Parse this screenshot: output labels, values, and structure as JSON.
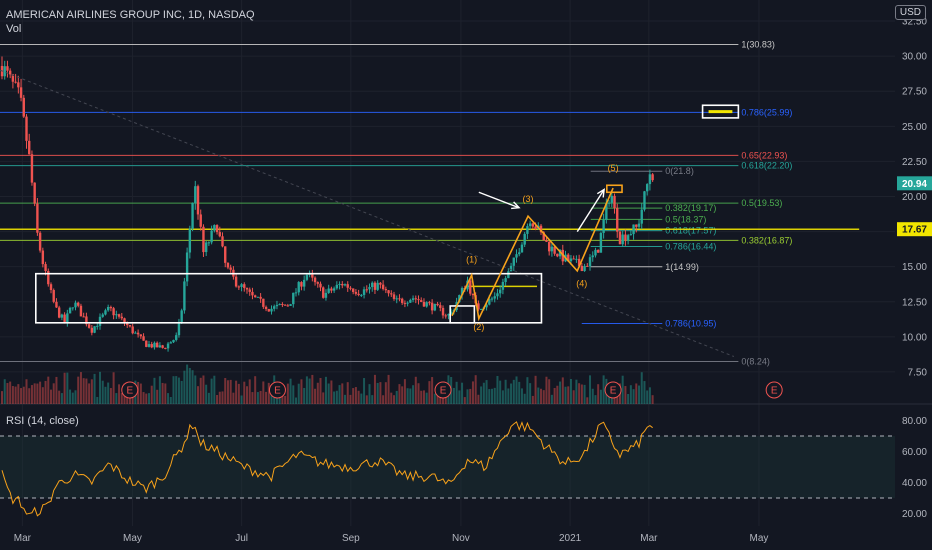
{
  "header": {
    "symbol_title": "AMERICAN AIRLINES GROUP INC, 1D, NASDAQ",
    "volume_label": "Vol",
    "currency_button": "USD"
  },
  "rsi_label": "RSI (14, close)",
  "colors": {
    "background": "#131722",
    "up": "#26a69a",
    "down": "#ef5350",
    "wave": "#f7a21b",
    "rsi": "#f7a21b",
    "fib_white": "#c8c8c8",
    "fib_blue": "#2962ff",
    "fib_green": "#4caf50",
    "yellow": "#f2e600"
  },
  "chart_data": {
    "type": "candlestick",
    "x_labels": [
      "Mar",
      "May",
      "Jul",
      "Sep",
      "Nov",
      "2021",
      "Mar",
      "May"
    ],
    "price_axis": {
      "ticks": [
        7.5,
        10,
        12.5,
        15,
        17.5,
        20,
        22.5,
        25,
        27.5,
        30,
        32.5
      ],
      "tick_labels": [
        "7.50",
        "10.00",
        "12.50",
        "15.00",
        "17.50",
        "20.00",
        "22.50",
        "25.00",
        "27.50",
        "30.00",
        "32.50"
      ],
      "range": [
        5.5,
        34
      ],
      "price_tags": [
        {
          "label": "20.94",
          "value": 20.94,
          "color": "#26a69a"
        },
        {
          "label": "17.67",
          "value": 17.67,
          "color": "#f2e600"
        }
      ]
    },
    "rsi_axis": {
      "ticks": [
        20,
        40,
        60,
        80
      ],
      "tick_labels": [
        "20.00",
        "40.00",
        "60.00",
        "80.00"
      ],
      "range": [
        12,
        88
      ],
      "bands": [
        30,
        70
      ]
    },
    "price_path": [
      [
        0,
        29.3
      ],
      [
        0.02,
        27.0
      ],
      [
        0.03,
        23.0
      ],
      [
        0.04,
        17.0
      ],
      [
        0.05,
        14.0
      ],
      [
        0.06,
        12.0
      ],
      [
        0.07,
        11.0
      ],
      [
        0.08,
        12.5
      ],
      [
        0.1,
        10.5
      ],
      [
        0.12,
        12.0
      ],
      [
        0.14,
        10.8
      ],
      [
        0.16,
        9.5
      ],
      [
        0.18,
        9.2
      ],
      [
        0.195,
        10.0
      ],
      [
        0.2,
        11.5
      ],
      [
        0.215,
        21.0
      ],
      [
        0.225,
        16.0
      ],
      [
        0.24,
        18.0
      ],
      [
        0.25,
        15.0
      ],
      [
        0.26,
        14.0
      ],
      [
        0.28,
        12.8
      ],
      [
        0.3,
        12.0
      ],
      [
        0.32,
        12.3
      ],
      [
        0.34,
        14.5
      ],
      [
        0.36,
        13.0
      ],
      [
        0.38,
        13.8
      ],
      [
        0.4,
        13.2
      ],
      [
        0.42,
        13.7
      ],
      [
        0.44,
        12.5
      ],
      [
        0.46,
        12.8
      ],
      [
        0.48,
        12.2
      ],
      [
        0.5,
        11.5
      ],
      [
        0.52,
        14.0
      ],
      [
        0.53,
        12.0
      ],
      [
        0.55,
        12.8
      ],
      [
        0.57,
        15.0
      ],
      [
        0.59,
        18.5
      ],
      [
        0.61,
        16.5
      ],
      [
        0.63,
        15.5
      ],
      [
        0.65,
        15.0
      ],
      [
        0.665,
        16.0
      ],
      [
        0.68,
        20.5
      ],
      [
        0.69,
        17.0
      ],
      [
        0.71,
        17.8
      ],
      [
        0.725,
        22.0
      ],
      [
        0.73,
        20.94
      ]
    ],
    "rsi_path": [
      [
        0,
        45
      ],
      [
        0.01,
        30
      ],
      [
        0.02,
        28
      ],
      [
        0.03,
        18
      ],
      [
        0.04,
        22
      ],
      [
        0.05,
        24
      ],
      [
        0.06,
        38
      ],
      [
        0.08,
        45
      ],
      [
        0.1,
        40
      ],
      [
        0.12,
        52
      ],
      [
        0.14,
        42
      ],
      [
        0.16,
        36
      ],
      [
        0.18,
        44
      ],
      [
        0.2,
        62
      ],
      [
        0.215,
        80
      ],
      [
        0.22,
        66
      ],
      [
        0.24,
        60
      ],
      [
        0.27,
        50
      ],
      [
        0.3,
        44
      ],
      [
        0.33,
        58
      ],
      [
        0.36,
        52
      ],
      [
        0.39,
        50
      ],
      [
        0.42,
        54
      ],
      [
        0.45,
        44
      ],
      [
        0.48,
        44
      ],
      [
        0.5,
        38
      ],
      [
        0.52,
        55
      ],
      [
        0.54,
        50
      ],
      [
        0.57,
        78
      ],
      [
        0.59,
        75
      ],
      [
        0.61,
        62
      ],
      [
        0.63,
        52
      ],
      [
        0.65,
        58
      ],
      [
        0.67,
        78
      ],
      [
        0.69,
        58
      ],
      [
        0.71,
        64
      ],
      [
        0.725,
        79
      ],
      [
        0.73,
        71
      ]
    ],
    "levels": [
      {
        "label": "1(30.83)",
        "value": 30.83,
        "x0": 0,
        "x1": 0.825,
        "color": "#c8c8c8"
      },
      {
        "label": "0.786(25.99)",
        "value": 25.99,
        "x0": 0,
        "x1": 0.825,
        "color": "#2962ff"
      },
      {
        "label": "0.65(22.93)",
        "value": 22.93,
        "x0": 0,
        "x1": 0.825,
        "color": "#ef5350"
      },
      {
        "label": "0.618(22.20)",
        "value": 22.2,
        "x0": 0,
        "x1": 0.825,
        "color": "#26a69a"
      },
      {
        "label": "0.5(19.53)",
        "value": 19.53,
        "x0": 0,
        "x1": 0.825,
        "color": "#4caf50"
      },
      {
        "label": "0.382(16.87)",
        "value": 16.87,
        "x0": 0,
        "x1": 0.825,
        "color": "#9acd32"
      },
      {
        "label": "0(8.24)",
        "value": 8.24,
        "x0": 0,
        "x1": 0.825,
        "color": "#787b86"
      },
      {
        "label": "0(21.8)",
        "value": 21.8,
        "x0": 0.66,
        "x1": 0.74,
        "color": "#787b86"
      },
      {
        "label": "0.382(19.17)",
        "value": 19.17,
        "x0": 0.66,
        "x1": 0.74,
        "color": "#4caf50"
      },
      {
        "label": "0.5(18.37)",
        "value": 18.37,
        "x0": 0.66,
        "x1": 0.74,
        "color": "#4caf50"
      },
      {
        "label": "0.618(17.57)",
        "value": 17.57,
        "x0": 0.66,
        "x1": 0.74,
        "color": "#26a69a"
      },
      {
        "label": "0.786(16.44)",
        "value": 16.44,
        "x0": 0.66,
        "x1": 0.74,
        "color": "#26a69a"
      },
      {
        "label": "1(14.99)",
        "value": 14.99,
        "x0": 0.66,
        "x1": 0.74,
        "color": "#c8c8c8"
      },
      {
        "label": "0.786(10.95)",
        "value": 10.95,
        "x0": 0.65,
        "x1": 0.74,
        "color": "#2962ff"
      },
      {
        "label": "",
        "value": 17.67,
        "x0": 0,
        "x1": 0.96,
        "color": "#f2e600"
      },
      {
        "label": "",
        "value": 13.6,
        "x0": 0.52,
        "x1": 0.6,
        "color": "#f2e600"
      }
    ],
    "wave_labels": [
      {
        "text": "(1)",
        "x": 0.527,
        "y": 15.3
      },
      {
        "text": "(2)",
        "x": 0.535,
        "y": 10.5
      },
      {
        "text": "(3)",
        "x": 0.59,
        "y": 19.6
      },
      {
        "text": "(4)",
        "x": 0.65,
        "y": 13.6
      },
      {
        "text": "(5)",
        "x": 0.685,
        "y": 21.8
      }
    ],
    "wave_path": [
      [
        0.505,
        11.5
      ],
      [
        0.527,
        14.4
      ],
      [
        0.535,
        11.3
      ],
      [
        0.59,
        18.6
      ],
      [
        0.645,
        14.7
      ],
      [
        0.685,
        20.6
      ]
    ],
    "earnings_markers": [
      {
        "text": "E",
        "x": 0.145
      },
      {
        "text": "E",
        "x": 0.31
      },
      {
        "text": "E",
        "x": 0.495
      },
      {
        "text": "E",
        "x": 0.685
      },
      {
        "text": "E",
        "x": 0.865
      }
    ],
    "annotations": {
      "range_box": {
        "x0": 0.04,
        "x1": 0.605,
        "y_top": 14.5,
        "y_bottom": 11.0
      },
      "small_box": {
        "x0": 0.503,
        "x1": 0.53,
        "y_top": 12.2,
        "y_bottom": 11.0
      },
      "target_box": {
        "x0": 0.785,
        "x1": 0.825,
        "y_top": 26.5,
        "y_bottom": 25.6
      },
      "high_box": {
        "x0": 0.678,
        "x1": 0.695,
        "y_top": 20.8,
        "y_bottom": 20.3
      },
      "trend_line": [
        [
          0,
          29.0
        ],
        [
          0.82,
          8.6
        ]
      ],
      "arrows": [
        {
          "from": [
            0.535,
            20.3
          ],
          "to": [
            0.58,
            19.2
          ]
        },
        {
          "from": [
            0.645,
            17.5
          ],
          "to": [
            0.675,
            20.5
          ]
        }
      ]
    }
  }
}
